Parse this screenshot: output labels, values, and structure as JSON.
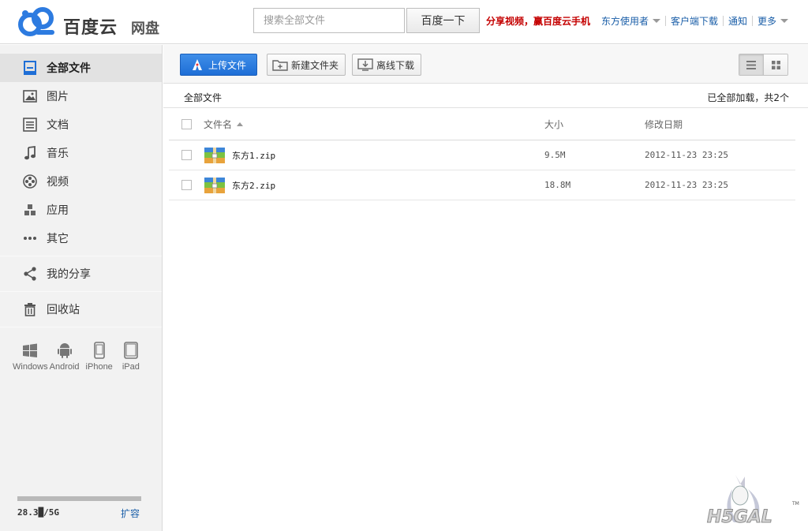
{
  "header": {
    "brand": "百度云",
    "brand_sub": "网盘",
    "search_placeholder": "搜索全部文件",
    "search_button": "百度一下",
    "promo": "分享视频，赢百度云手机",
    "nav": [
      "东方使用者",
      "客户端下载",
      "通知",
      "更多"
    ]
  },
  "sidebar": {
    "items": [
      {
        "label": "全部文件",
        "icon": "all-files-icon",
        "active": true
      },
      {
        "label": "图片",
        "icon": "image-icon"
      },
      {
        "label": "文档",
        "icon": "document-icon"
      },
      {
        "label": "音乐",
        "icon": "music-icon"
      },
      {
        "label": "视频",
        "icon": "video-icon"
      },
      {
        "label": "应用",
        "icon": "app-icon"
      },
      {
        "label": "其它",
        "icon": "more-dots-icon"
      },
      {
        "label": "我的分享",
        "icon": "share-icon"
      },
      {
        "label": "回收站",
        "icon": "trash-icon"
      }
    ],
    "clients": [
      "Windows",
      "Android",
      "iPhone",
      "iPad"
    ],
    "quota_used": "28.3█/5G",
    "quota_expand": "扩容"
  },
  "toolbar": {
    "upload": "上传文件",
    "new_folder": "新建文件夹",
    "offline_download": "离线下载"
  },
  "breadcrumb": "全部文件",
  "load_status": "已全部加载，共2个",
  "table": {
    "columns": [
      "文件名",
      "大小",
      "修改日期"
    ],
    "rows": [
      {
        "name": "东方1.zip",
        "size": "9.5M",
        "date": "2012-11-23 23:25"
      },
      {
        "name": "东方2.zip",
        "size": "18.8M",
        "date": "2012-11-23 23:25"
      }
    ]
  },
  "watermark": "H5GAL",
  "watermark_tm": "TM"
}
